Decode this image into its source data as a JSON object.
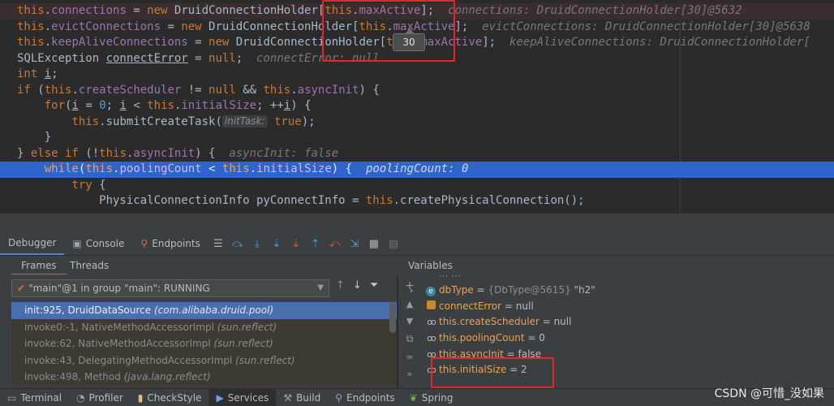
{
  "editor": {
    "lines": [
      {
        "parts": [
          [
            "kw",
            "this"
          ],
          [
            "plain",
            "."
          ],
          [
            "fld",
            "connections"
          ],
          [
            "plain",
            " = "
          ],
          [
            "kw",
            "new "
          ],
          [
            "plain",
            "DruidConnectionHolder["
          ],
          [
            "kw",
            "this"
          ],
          [
            "plain",
            "."
          ],
          [
            "fld",
            "maxActive"
          ],
          [
            "plain",
            "];"
          ],
          [
            "hint",
            "  connections: DruidConnectionHolder[30]@5632"
          ]
        ]
      },
      {
        "parts": [
          [
            "kw",
            "this"
          ],
          [
            "plain",
            "."
          ],
          [
            "fld",
            "evictConnections"
          ],
          [
            "plain",
            " = "
          ],
          [
            "kw",
            "new "
          ],
          [
            "plain",
            "DruidConnectionHolder["
          ],
          [
            "kw",
            "this"
          ],
          [
            "plain",
            "."
          ],
          [
            "fld",
            "maxActive"
          ],
          [
            "plain",
            "];"
          ],
          [
            "hint",
            "  evictConnections: DruidConnectionHolder[30]@5638"
          ]
        ]
      },
      {
        "parts": [
          [
            "kw",
            "this"
          ],
          [
            "plain",
            "."
          ],
          [
            "fld",
            "keepAliveConnections"
          ],
          [
            "plain",
            " = "
          ],
          [
            "kw",
            "new "
          ],
          [
            "plain",
            "DruidConnectionHolder["
          ],
          [
            "kw",
            "this"
          ],
          [
            "plain",
            "."
          ],
          [
            "fld",
            "maxActive"
          ],
          [
            "plain",
            "];"
          ],
          [
            "hint",
            "  keepAliveConnections: DruidConnectionHolder["
          ]
        ]
      },
      {
        "parts": [
          [
            "plain",
            "SQLException "
          ],
          [
            "uplain",
            "connectError"
          ],
          [
            "plain",
            " = "
          ],
          [
            "kw",
            "null"
          ],
          [
            "plain",
            ";"
          ],
          [
            "hint",
            "  connectError: null"
          ]
        ]
      },
      {
        "parts": [
          [
            "kw",
            "int "
          ],
          [
            "uplain",
            "i"
          ],
          [
            "plain",
            ";"
          ]
        ]
      },
      {
        "parts": [
          [
            "kw",
            "if "
          ],
          [
            "plain",
            "("
          ],
          [
            "kw",
            "this"
          ],
          [
            "plain",
            "."
          ],
          [
            "fld",
            "createScheduler"
          ],
          [
            "plain",
            " != "
          ],
          [
            "kw",
            "null"
          ],
          [
            "plain",
            " && "
          ],
          [
            "kw",
            "this"
          ],
          [
            "plain",
            "."
          ],
          [
            "fld",
            "asyncInit"
          ],
          [
            "plain",
            ") {"
          ]
        ]
      },
      {
        "parts": [
          [
            "plain",
            "    "
          ],
          [
            "kw",
            "for"
          ],
          [
            "plain",
            "("
          ],
          [
            "uplain",
            "i"
          ],
          [
            "plain",
            " = "
          ],
          [
            "num",
            "0"
          ],
          [
            "plain",
            "; "
          ],
          [
            "uplain",
            "i"
          ],
          [
            "plain",
            " < "
          ],
          [
            "kw",
            "this"
          ],
          [
            "plain",
            "."
          ],
          [
            "fld",
            "initialSize"
          ],
          [
            "plain",
            "; ++"
          ],
          [
            "uplain",
            "i"
          ],
          [
            "plain",
            ") {"
          ]
        ]
      },
      {
        "parts": [
          [
            "plain",
            "        "
          ],
          [
            "kw",
            "this"
          ],
          [
            "plain",
            ".submitCreateTask("
          ],
          [
            "inlay",
            "initTask:"
          ],
          [
            "kw",
            " true"
          ],
          [
            "plain",
            ");"
          ]
        ]
      },
      {
        "parts": [
          [
            "plain",
            "    }"
          ]
        ]
      },
      {
        "parts": [
          [
            "plain",
            "} "
          ],
          [
            "kw",
            "else if "
          ],
          [
            "plain",
            "(!"
          ],
          [
            "kw",
            "this"
          ],
          [
            "plain",
            "."
          ],
          [
            "fld",
            "asyncInit"
          ],
          [
            "plain",
            ") {"
          ],
          [
            "hint",
            "  asyncInit: false"
          ]
        ]
      },
      {
        "parts": [
          [
            "plain",
            "    "
          ],
          [
            "kw",
            "while"
          ],
          [
            "plain",
            "("
          ],
          [
            "kw",
            "this"
          ],
          [
            "plain",
            "."
          ],
          [
            "fld",
            "poolingCount"
          ],
          [
            "plain",
            " < "
          ],
          [
            "kw",
            "this"
          ],
          [
            "plain",
            "."
          ],
          [
            "fld",
            "initialSize"
          ],
          [
            "plain",
            ") {"
          ],
          [
            "hint",
            "  poolingCount: 0"
          ]
        ]
      },
      {
        "parts": [
          [
            "plain",
            "        "
          ],
          [
            "kw",
            "try "
          ],
          [
            "plain",
            "{"
          ]
        ]
      },
      {
        "parts": [
          [
            "plain",
            "            PhysicalConnectionInfo pyConnectInfo = "
          ],
          [
            "kw",
            "this"
          ],
          [
            "plain",
            ".createPhysicalConnection();"
          ]
        ]
      }
    ],
    "tooltip_value": "30"
  },
  "debugger": {
    "tabs": [
      {
        "label": "Debugger",
        "icon": "none"
      },
      {
        "label": "Console",
        "icon": "console-icon"
      },
      {
        "label": "Endpoints",
        "icon": "endpoints-icon"
      }
    ],
    "subtabs": {
      "frames": "Frames",
      "threads": "Threads",
      "variables": "Variables"
    },
    "thread_selector": "\"main\"@1 in group \"main\": RUNNING",
    "frames": [
      {
        "method": "init:925, DruidDataSource",
        "pkg": "(com.alibaba.druid.pool)"
      },
      {
        "method": "invoke0:-1, NativeMethodAccessorImpl",
        "pkg": "(sun.reflect)"
      },
      {
        "method": "invoke:62, NativeMethodAccessorImpl",
        "pkg": "(sun.reflect)"
      },
      {
        "method": "invoke:43, DelegatingMethodAccessorImpl",
        "pkg": "(sun.reflect)"
      },
      {
        "method": "invoke:498, Method",
        "pkg": "(java.lang.reflect)"
      }
    ],
    "variables": [
      {
        "icon": "enum-icon",
        "name": "dbType",
        "eq": " = ",
        "type": "{DbType@5615}",
        "value": " \"h2\"",
        "expandable": true
      },
      {
        "icon": "field-icon",
        "name": "connectError",
        "eq": " = ",
        "type": "",
        "value": "null"
      },
      {
        "icon": "watch-icon",
        "name": "this.createScheduler",
        "eq": " = ",
        "type": "",
        "value": "null"
      },
      {
        "icon": "watch-icon",
        "name": "this.poolingCount",
        "eq": " = ",
        "type": "",
        "value": "0"
      },
      {
        "icon": "watch-icon",
        "name": "this.asyncInit",
        "eq": " = ",
        "type": "",
        "value": "false"
      },
      {
        "icon": "watch-icon",
        "name": "this.initialSize",
        "eq": " = ",
        "type": "",
        "value": "2"
      }
    ]
  },
  "statusbar": [
    {
      "label": "Terminal",
      "icon": "terminal-icon"
    },
    {
      "label": "Profiler",
      "icon": "profiler-icon"
    },
    {
      "label": "CheckStyle",
      "icon": "checkstyle-icon"
    },
    {
      "label": "Services",
      "icon": "services-icon",
      "active": true
    },
    {
      "label": "Build",
      "icon": "build-icon"
    },
    {
      "label": "Endpoints",
      "icon": "endpoints-icon"
    },
    {
      "label": "Spring",
      "icon": "spring-icon"
    }
  ],
  "watermark": "CSDN @可惜_没如果"
}
